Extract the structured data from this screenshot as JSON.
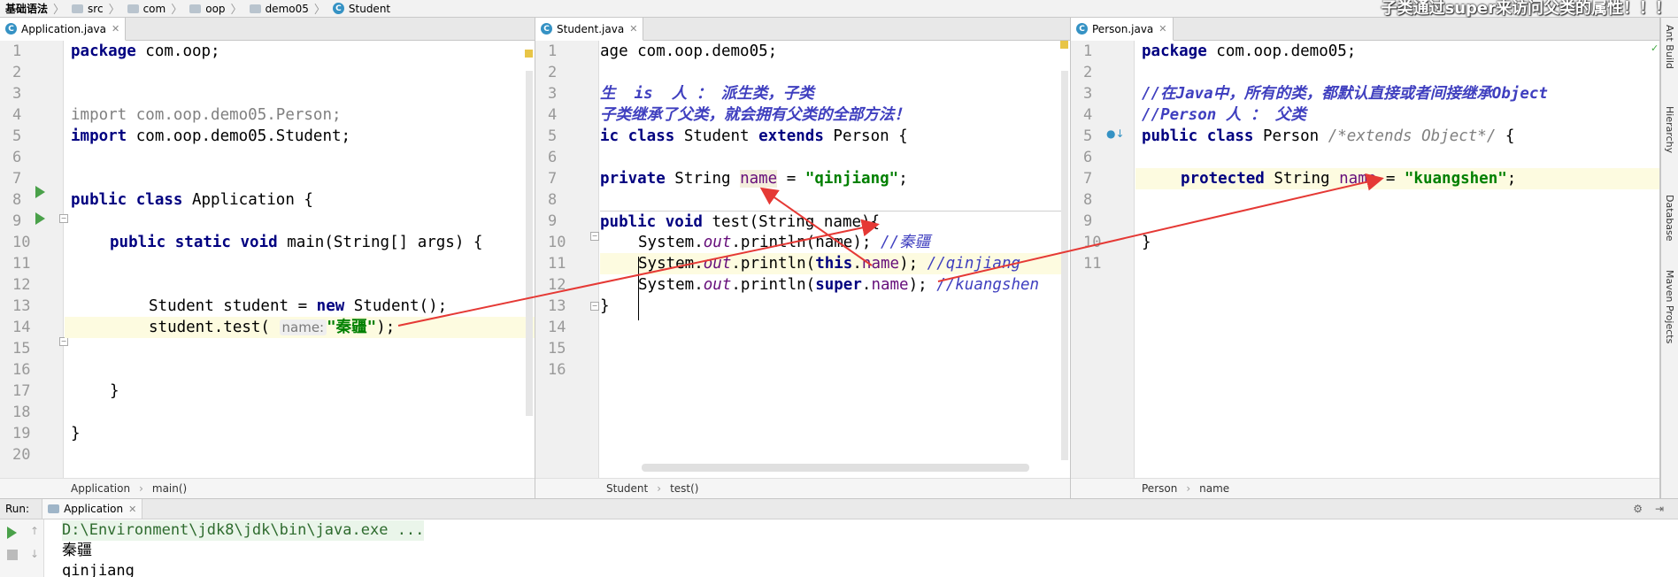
{
  "navbar": {
    "crumbs": [
      {
        "label": "基础语法",
        "icon": "project-icon"
      },
      {
        "label": "src",
        "icon": "folder-icon"
      },
      {
        "label": "com",
        "icon": "folder-icon"
      },
      {
        "label": "oop",
        "icon": "folder-icon"
      },
      {
        "label": "demo05",
        "icon": "folder-icon"
      },
      {
        "label": "Student",
        "icon": "class-icon"
      }
    ],
    "overlay_caption": "子类通过super来访问父类的属性！！！"
  },
  "panes": [
    {
      "tab": "Application.java",
      "line_count": 20,
      "status": [
        "Application",
        "main()"
      ]
    },
    {
      "tab": "Student.java",
      "line_count": 16,
      "status": [
        "Student",
        "test()"
      ]
    },
    {
      "tab": "Person.java",
      "line_count": 11,
      "status": [
        "Person",
        "name"
      ]
    }
  ],
  "sidebar": {
    "items": [
      "Ant Build",
      "Hierarchy",
      "Database",
      "Maven Projects"
    ]
  },
  "run": {
    "label": "Run:",
    "tab": "Application",
    "output": [
      "D:\\Environment\\jdk8\\jdk\\bin\\java.exe ...",
      "秦疆",
      "qinjiang"
    ]
  },
  "code": {
    "app": {
      "l1_kw": "package",
      "l1_rest": " com.oop;",
      "l4_kw": "import",
      "l4_rest": " com.oop.demo05.Person;",
      "l5_kw": "import",
      "l5_rest": " com.oop.demo05.Student;",
      "l8_kw": "public class",
      "l8_rest": " Application {",
      "l10_kw": "public static void",
      "l10_rest": " main(String[] args) {",
      "l13_a": "Student student = ",
      "l13_kw": "new",
      "l13_b": " Student();",
      "l14_a": "student.test( ",
      "l14_hint": "name:",
      "l14_str": "\"秦疆\"",
      "l14_b": ");",
      "l17": "}",
      "l19": "}"
    },
    "student": {
      "l1_rest": "age com.oop.demo05;",
      "l3": "生  is  人 ： 派生类，子类",
      "l4": "子类继承了父类，就会拥有父类的全部方法！",
      "l5_a": "ic class",
      "l5_b": " Student ",
      "l5_kw": "extends",
      "l5_c": " Person {",
      "l7_kw": "private",
      "l7_a": " String ",
      "l7_name": "name",
      "l7_b": " = ",
      "l7_str": "\"qinjiang\"",
      "l7_c": ";",
      "l9_kw": "public void",
      "l9_rest": " test(String name){",
      "l10_a": "System.",
      "l10_out": "out",
      "l10_b": ".println(name); ",
      "l10_cm": "//秦疆",
      "l11_a": "System.",
      "l11_out": "out",
      "l11_b": ".println(",
      "l11_kw": "this",
      "l11_c": ".",
      "l11_fld": "name",
      "l11_d": "); ",
      "l11_cm": "//qinjiang",
      "l12_a": "System.",
      "l12_out": "out",
      "l12_b": ".println(",
      "l12_kw": "super",
      "l12_c": ".",
      "l12_fld": "name",
      "l12_d": "); ",
      "l12_cm": "//kuangshen",
      "l13": "}"
    },
    "person": {
      "l1_kw": "package",
      "l1_rest": " com.oop.demo05;",
      "l3": "//在Java中，所有的类，都默认直接或者间接继承Object",
      "l4": "//Person 人 ： 父类",
      "l5_kw": "public class",
      "l5_rest": " Person ",
      "l5_cm": "/*extends Object*/",
      "l5_end": " {",
      "l7_kw": "protected",
      "l7_a": " String ",
      "l7_fld": "name",
      "l7_b": " = ",
      "l7_str": "\"kuangshen\"",
      "l7_c": ";",
      "l10": "}"
    }
  },
  "colors": {
    "keyword": "#000080",
    "string": "#008000",
    "comment": "#3f3fbf",
    "annotation_arrow": "#e53935",
    "highlight_line": "#fdfbe0"
  }
}
